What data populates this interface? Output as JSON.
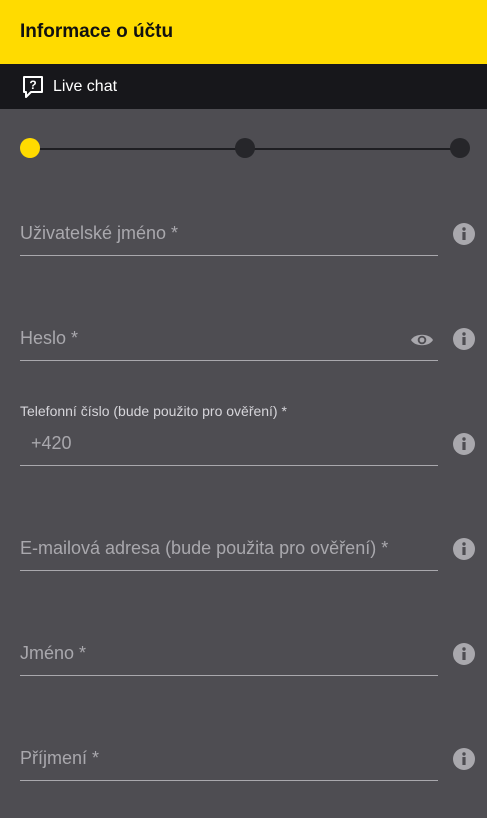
{
  "header": {
    "title": "Informace o účtu"
  },
  "chatbar": {
    "label": "Live chat",
    "icon": "chat-question-icon"
  },
  "stepper": {
    "steps": 3,
    "current_step": 1
  },
  "form": {
    "username": {
      "label": "Uživatelské jméno *"
    },
    "password": {
      "label": "Heslo *"
    },
    "phone": {
      "label": "Telefonní číslo (bude použito pro ověření) *",
      "value": "+420"
    },
    "email": {
      "label": "E-mailová adresa (bude použita pro ověření) *"
    },
    "first_name": {
      "label": "Jméno *"
    },
    "last_name": {
      "label": "Příjmení *"
    }
  },
  "colors": {
    "accent": "#ffdb00",
    "background": "#4e4d52",
    "bar": "#17171b"
  }
}
